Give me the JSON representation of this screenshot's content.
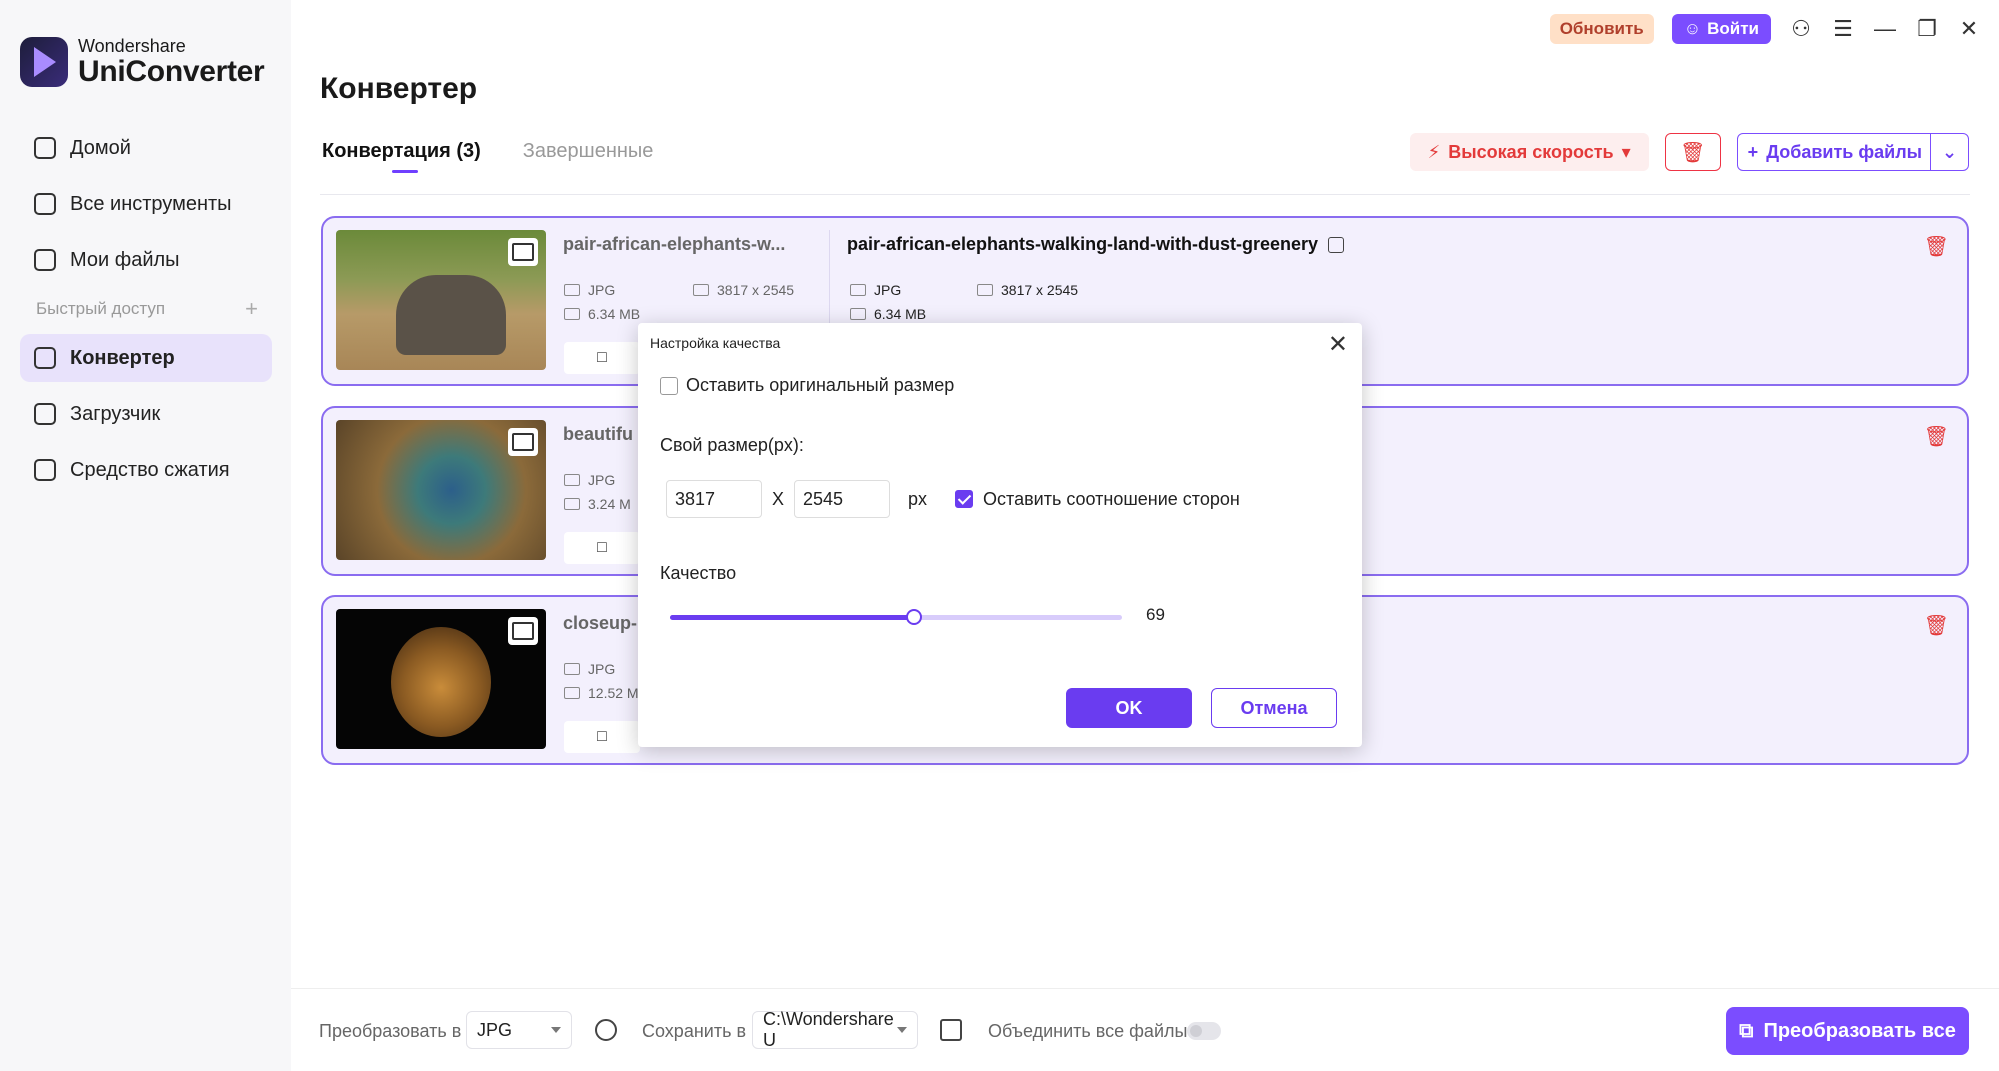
{
  "brand": {
    "small": "Wondershare",
    "big": "UniConverter"
  },
  "sidebar": {
    "items": [
      {
        "label": "Домой",
        "icon": "home-icon"
      },
      {
        "label": "Все инструменты",
        "icon": "toolbox-icon"
      },
      {
        "label": "Мои файлы",
        "icon": "file-icon"
      }
    ],
    "quick_access": "Быстрый доступ",
    "quick_items": [
      {
        "label": "Конвертер",
        "icon": "converter-icon",
        "active": true
      },
      {
        "label": "Загрузчик",
        "icon": "download-icon"
      },
      {
        "label": "Средство сжатия",
        "icon": "compress-icon"
      }
    ]
  },
  "topbar": {
    "update": "Обновить",
    "login": "Войти"
  },
  "page": {
    "title": "Конвертер",
    "tabs": [
      "Конвертация (3)",
      "Завершенные"
    ]
  },
  "toolbar": {
    "speed": "Высокая скорость",
    "add_files": "Добавить файлы"
  },
  "files": [
    {
      "src_name": "pair-african-elephants-w...",
      "dst_name": "pair-african-elephants-walking-land-with-dust-greenery",
      "format": "JPG",
      "size": "6.34 MB",
      "resolution": "3817 x 2545",
      "dst_format": "JPG",
      "dst_size": "6.34 MB",
      "dst_resolution": "3817 x 2545"
    },
    {
      "src_name": "beautifu",
      "format": "JPG",
      "size": "3.24 M"
    },
    {
      "src_name": "closeup-",
      "format": "JPG",
      "size": "12.52 M"
    }
  ],
  "bottom": {
    "convert_to_label": "Преобразовать в",
    "convert_to_value": "JPG",
    "save_to_label": "Сохранить в",
    "save_to_value": "C:\\Wondershare U",
    "merge_label": "Объединить все файлы",
    "convert_all": "Преобразовать все"
  },
  "dialog": {
    "title": "Настройка качества",
    "keep_original": "Оставить оригинальный размер",
    "custom_size": "Свой размер(px):",
    "width": "3817",
    "x": "X",
    "height": "2545",
    "unit": "px",
    "keep_ratio": "Оставить соотношение сторон",
    "quality_label": "Качество",
    "quality_value": "69",
    "ok": "OK",
    "cancel": "Отмена"
  },
  "colors": {
    "accent": "#6a3cf0",
    "danger": "#e33a3a"
  }
}
